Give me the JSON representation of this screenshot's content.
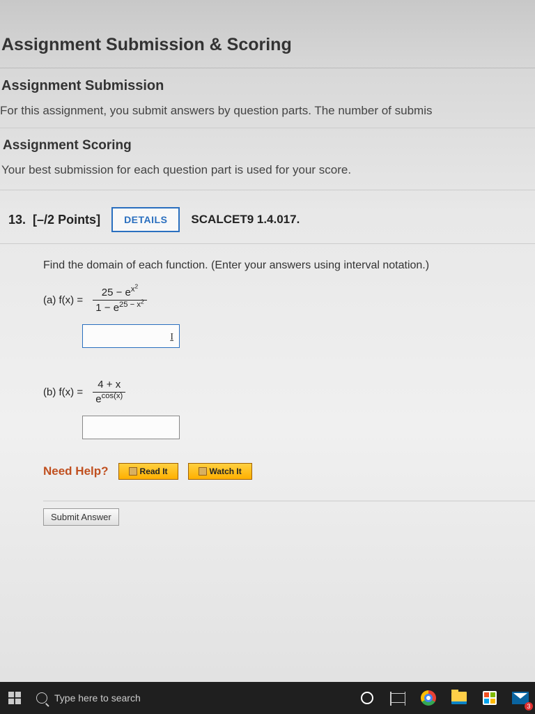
{
  "header": {
    "title": "Assignment Submission & Scoring",
    "submission_heading": "Assignment Submission",
    "submission_desc": "For this assignment, you submit answers by question parts. The number of submis",
    "scoring_heading": "Assignment Scoring",
    "scoring_desc": "Your best submission for each question part is used for your score."
  },
  "question": {
    "number_label": "13.",
    "points_label": "[–/2 Points]",
    "details_btn": "DETAILS",
    "reference": "SCALCET9 1.4.017.",
    "prompt": "Find the domain of each function. (Enter your answers using interval notation.)",
    "part_a": {
      "label": "(a)   f(x) =",
      "numerator": "25 − e^{x^2}",
      "denominator": "1 − e^{25 − x^2}"
    },
    "part_b": {
      "label": "(b)   f(x) =",
      "numerator": "4 + x",
      "denominator": "e^{cos(x)}"
    },
    "need_help_label": "Need Help?",
    "read_it_btn": "Read It",
    "watch_it_btn": "Watch It",
    "submit_btn": "Submit Answer"
  },
  "taskbar": {
    "search_placeholder": "Type here to search",
    "mail_badge": "3"
  }
}
